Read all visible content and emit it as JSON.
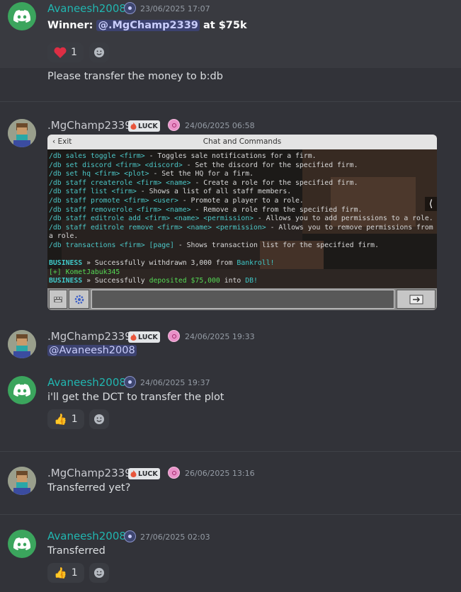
{
  "colors": {
    "background": "#323339",
    "username_discord": "#21b6b0",
    "mention_bg": "#3c4270"
  },
  "messages": [
    {
      "author": "Avaneesh2008",
      "timestamp": "23/06/2025 17:07",
      "winner_label": "Winner:",
      "winner_mention": "@.MgChamp2339",
      "winner_suffix": "at $75k",
      "reaction": {
        "emoji": "heart",
        "count": "1"
      },
      "followup": "Please transfer the money to b:db"
    },
    {
      "author": ".MgChamp2339",
      "tag": "LUCK",
      "timestamp": "24/06/2025 06:58",
      "screenshot": {
        "exit_label": "Exit",
        "title": "Chat and Commands",
        "lines": [
          [
            {
              "t": "/db sales toggle <firm>",
              "c": "cmd"
            },
            {
              "t": " - Toggles sale notifications for a firm.",
              "c": ""
            }
          ],
          [
            {
              "t": "/db set discord <firm> <discord>",
              "c": "cmd"
            },
            {
              "t": " - Set the discord for the specified firm.",
              "c": ""
            }
          ],
          [
            {
              "t": "/db set hq <firm> <plot>",
              "c": "cmd"
            },
            {
              "t": " - Set the HQ for a firm.",
              "c": ""
            }
          ],
          [
            {
              "t": "/db staff createrole <firm> <name>",
              "c": "cmd"
            },
            {
              "t": " - Create a role for the specified firm.",
              "c": ""
            }
          ],
          [
            {
              "t": "/db staff list <firm>",
              "c": "cmd"
            },
            {
              "t": " - Shows a list of all staff members.",
              "c": ""
            }
          ],
          [
            {
              "t": "/db staff promote <firm> <user>",
              "c": "cmd"
            },
            {
              "t": " - Promote a player to a role.",
              "c": ""
            }
          ],
          [
            {
              "t": "/db staff removerole <firm> <name>",
              "c": "cmd"
            },
            {
              "t": " - Remove a role from the specified firm.",
              "c": ""
            }
          ],
          [
            {
              "t": "/db staff editrole add <firm> <name> <permission>",
              "c": "cmd"
            },
            {
              "t": " - Allows you to add permissions to a role.",
              "c": ""
            }
          ],
          [
            {
              "t": "/db staff editrole remove <firm> <name> <permission>",
              "c": "cmd"
            },
            {
              "t": " - Allows you to remove permissions from",
              "c": ""
            }
          ],
          [
            {
              "t": "a role.",
              "c": ""
            }
          ],
          [
            {
              "t": "/db transactions <firm> [page]",
              "c": "cmd"
            },
            {
              "t": " - Shows transaction list for the specified firm.",
              "c": ""
            }
          ],
          [
            {
              "t": " ",
              "c": ""
            }
          ],
          [
            {
              "t": "BUSINESS",
              "c": "busi"
            },
            {
              "t": " » Successfully withdrawn 3,000 from ",
              "c": ""
            },
            {
              "t": "Bankroll!",
              "c": "aqua"
            }
          ],
          [
            {
              "t": "[+] KometJabuk345",
              "c": "green"
            }
          ],
          [
            {
              "t": "BUSINESS",
              "c": "busi"
            },
            {
              "t": " » Successfully ",
              "c": ""
            },
            {
              "t": "deposited $75,000",
              "c": "green"
            },
            {
              "t": " into ",
              "c": ""
            },
            {
              "t": "DB!",
              "c": "aqua"
            }
          ]
        ]
      }
    },
    {
      "author": ".MgChamp2339",
      "tag": "LUCK",
      "timestamp": "24/06/2025 19:33",
      "text": "@Avaneesh2008"
    },
    {
      "author": "Avaneesh2008",
      "timestamp": "24/06/2025 19:37",
      "text": "i'll get the DCT to transfer the plot",
      "reaction": {
        "emoji": "thumbs-up",
        "count": "1"
      }
    },
    {
      "author": ".MgChamp2339",
      "tag": "LUCK",
      "timestamp": "26/06/2025 13:16",
      "text": "Transferred yet?"
    },
    {
      "author": "Avaneesh2008",
      "timestamp": "27/06/2025 02:03",
      "text": "Transferred",
      "reaction": {
        "emoji": "thumbs-up",
        "count": "1"
      }
    }
  ]
}
